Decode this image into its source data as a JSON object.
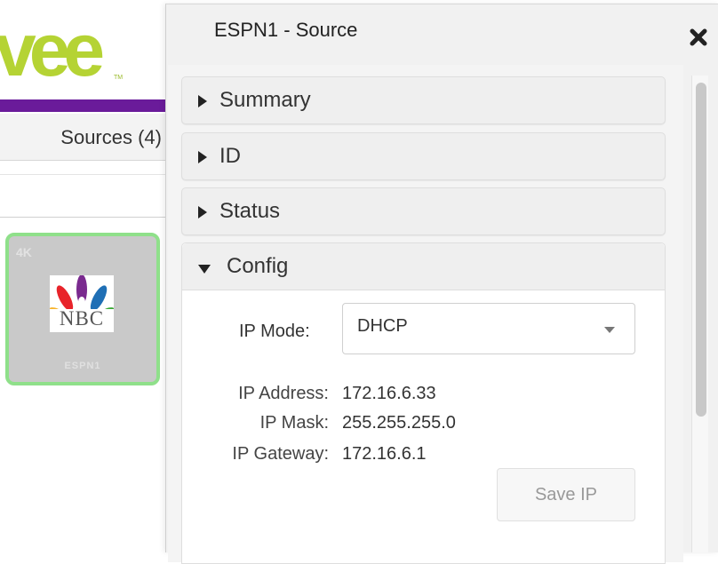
{
  "background": {
    "logo_text": "vee",
    "logo_tm": "TM",
    "sources_tab_label": "Sources (4)",
    "tile": {
      "badge": "4K",
      "logo_text": "NBC",
      "name": "ESPN1"
    }
  },
  "dialog": {
    "title": "ESPN1 - Source",
    "close_icon": "close-icon",
    "sections": [
      {
        "label": "Summary",
        "expanded": false
      },
      {
        "label": "ID",
        "expanded": false
      },
      {
        "label": "Status",
        "expanded": false
      },
      {
        "label": "Config",
        "expanded": true
      }
    ],
    "config": {
      "ip_mode_label": "IP Mode:",
      "ip_mode_value": "DHCP",
      "fields": [
        {
          "label": "IP Address:",
          "value": "172.16.6.33"
        },
        {
          "label": "IP Mask:",
          "value": "255.255.255.0"
        },
        {
          "label": "IP Gateway:",
          "value": "172.16.6.1"
        }
      ],
      "save_button": "Save IP"
    }
  },
  "colors": {
    "logo_green": "#b5d334",
    "brand_purple": "#6a1b9a",
    "tile_border": "#8fe08a"
  }
}
